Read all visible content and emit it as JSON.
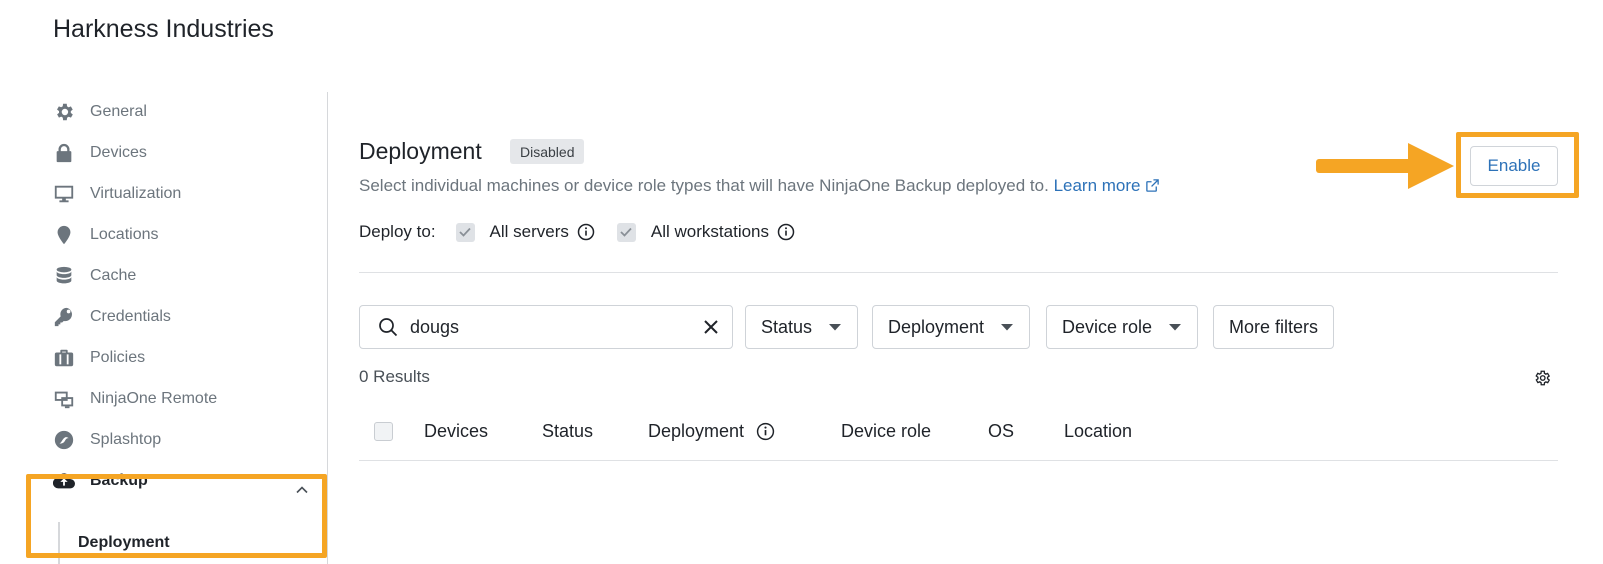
{
  "org": {
    "title": "Harkness Industries"
  },
  "sidebar": {
    "items": [
      {
        "label": "General",
        "icon": "gear-icon"
      },
      {
        "label": "Devices",
        "icon": "lock-icon"
      },
      {
        "label": "Virtualization",
        "icon": "monitor-icon"
      },
      {
        "label": "Locations",
        "icon": "map-pin-icon"
      },
      {
        "label": "Cache",
        "icon": "database-icon"
      },
      {
        "label": "Credentials",
        "icon": "key-icon"
      },
      {
        "label": "Policies",
        "icon": "briefcase-icon"
      },
      {
        "label": "NinjaOne Remote",
        "icon": "remote-screens-icon"
      },
      {
        "label": "Splashtop",
        "icon": "splashtop-icon"
      },
      {
        "label": "Backup",
        "icon": "cloud-upload-icon",
        "expanded": true
      }
    ],
    "subitems": [
      {
        "label": "Deployment",
        "active": true
      }
    ]
  },
  "main": {
    "title": "Deployment",
    "status_badge": "Disabled",
    "description": "Select individual machines or device role types that will have NinjaOne Backup deployed to.",
    "learn_more": "Learn more",
    "deploy_to": {
      "label": "Deploy to:",
      "options": [
        {
          "label": "All servers",
          "checked": true
        },
        {
          "label": "All workstations",
          "checked": true
        }
      ]
    },
    "enable_label": "Enable",
    "search": {
      "value": "dougs",
      "placeholder": ""
    },
    "filters": [
      "Status",
      "Deployment",
      "Device role",
      "More filters"
    ],
    "results": "0 Results",
    "table": {
      "columns": [
        "Devices",
        "Status",
        "Deployment",
        "Device role",
        "OS",
        "Location"
      ],
      "rows": []
    }
  },
  "colors": {
    "highlight": "#f5a524",
    "link": "#2d72b8",
    "muted_text": "#6c757d"
  }
}
